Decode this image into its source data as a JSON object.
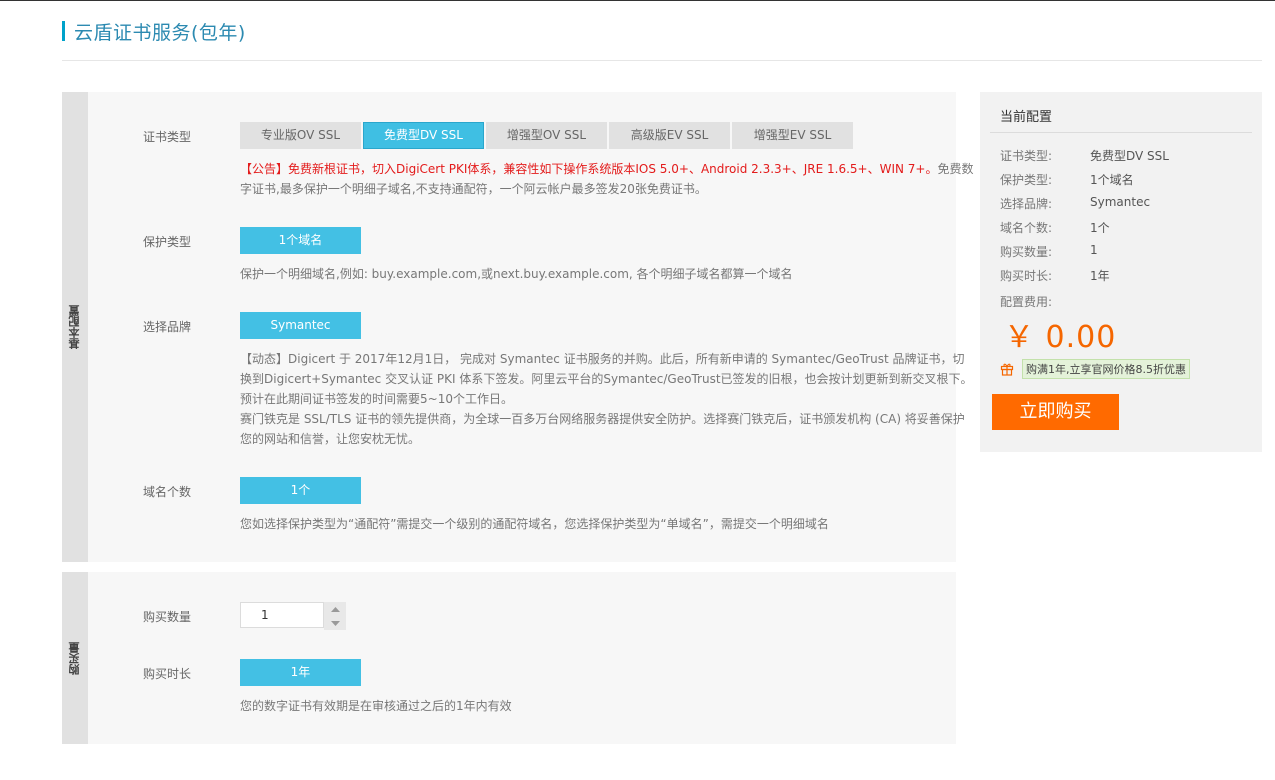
{
  "page": {
    "title": "云盾证书服务(包年)"
  },
  "section_basic": {
    "label": "基本配置",
    "cert_type": {
      "label": "证书类型",
      "tabs": [
        "专业版OV SSL",
        "免费型DV SSL",
        "增强型OV SSL",
        "高级版EV SSL",
        "增强型EV SSL"
      ],
      "active_index": 1,
      "notice": "【公告】免费新根证书，切入DigiCert PKI体系，兼容性如下操作系统版本IOS 5.0+、Android 2.3.3+、JRE 1.6.5+、WIN 7+。",
      "description": "免费数字证书,最多保护一个明细子域名,不支持通配符，一个阿云帐户最多签发20张免费证书。"
    },
    "protect_type": {
      "label": "保护类型",
      "value": "1个域名",
      "description": "保护一个明细域名,例如: buy.example.com,或next.buy.example.com, 各个明细子域名都算一个域名"
    },
    "brand": {
      "label": "选择品牌",
      "value": "Symantec",
      "description_1": "【动态】Digicert 于 2017年12月1日， 完成对 Symantec 证书服务的并购。此后，所有新申请的 Symantec/GeoTrust 品牌证书，切换到Digicert+Symantec 交叉认证 PKI 体系下签发。阿里云平台的Symantec/GeoTrust已签发的旧根，也会按计划更新到新交叉根下。预计在此期间证书签发的时间需要5~10个工作日。",
      "description_2": "赛门铁克是 SSL/TLS 证书的领先提供商，为全球一百多万台网络服务器提供安全防护。选择赛门铁克后，证书颁发机构 (CA) 将妥善保护您的网站和信誉，让您安枕无忧。"
    },
    "domain_count": {
      "label": "域名个数",
      "value": "1个",
      "description": "您如选择保护类型为“通配符”需提交一个级别的通配符域名，您选择保护类型为“单域名”，需提交一个明细域名"
    }
  },
  "section_purchase": {
    "label": "购买量",
    "quantity": {
      "label": "购买数量",
      "value": "1"
    },
    "duration": {
      "label": "购买时长",
      "value": "1年",
      "description": "您的数字证书有效期是在审核通过之后的1年内有效"
    }
  },
  "summary": {
    "title": "当前配置",
    "rows": [
      {
        "key": "证书类型:",
        "value": "免费型DV SSL"
      },
      {
        "key": "保护类型:",
        "value": "1个域名"
      },
      {
        "key": "选择品牌:",
        "value": "Symantec"
      },
      {
        "key": "域名个数:",
        "value": "1个"
      },
      {
        "key": "购买数量:",
        "value": "1"
      },
      {
        "key": "购买时长:",
        "value": "1年"
      }
    ],
    "fee_label": "配置费用:",
    "price": "￥ 0.00",
    "promo": "购满1年,立享官网价格8.5折优惠",
    "buy_button": "立即购买"
  },
  "colors": {
    "accent": "#00a2ca",
    "selected": "#43c0e4",
    "notice": "#e31b1b",
    "price": "#f56600",
    "buy_button": "#ff6a00"
  }
}
